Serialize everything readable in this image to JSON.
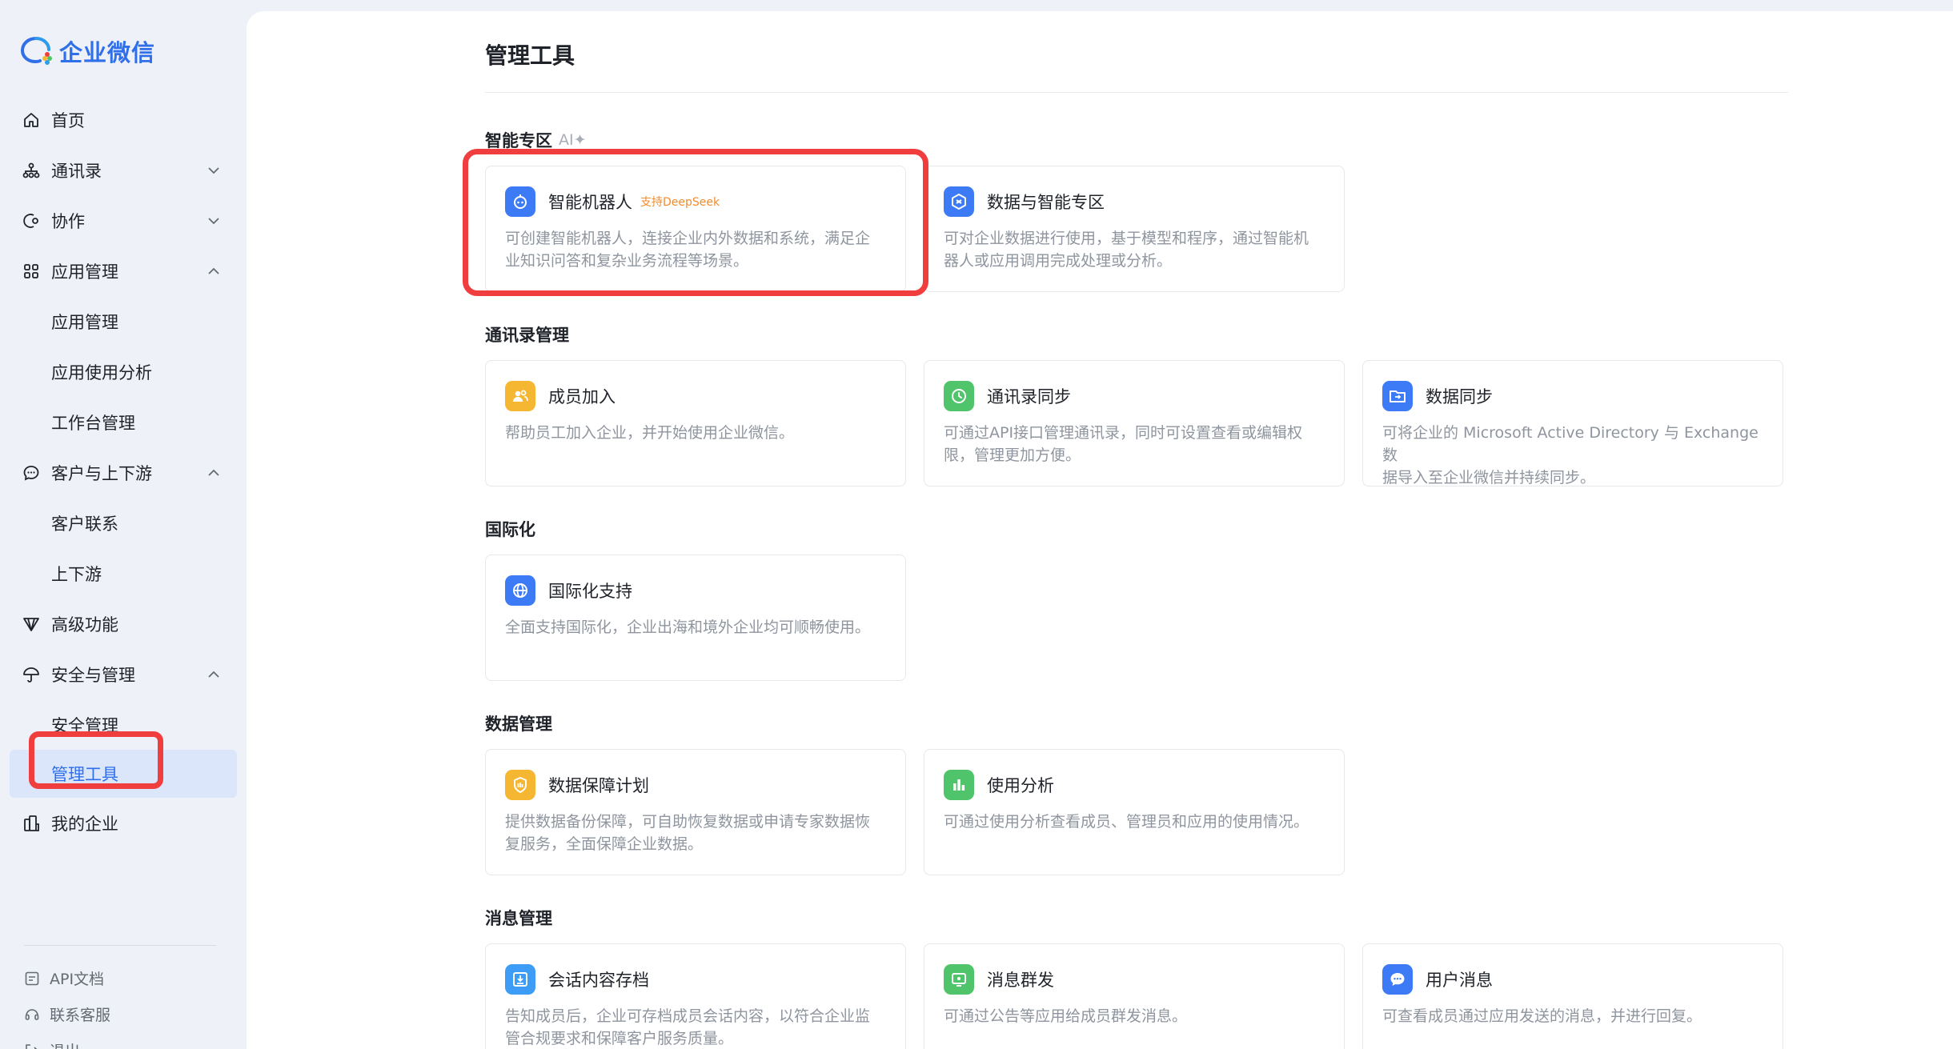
{
  "logo": {
    "text": "企业微信"
  },
  "sidebar": {
    "items": [
      {
        "label": "首页",
        "icon": "home-icon"
      },
      {
        "label": "通讯录",
        "icon": "org-chart-icon",
        "chevron": "down"
      },
      {
        "label": "协作",
        "icon": "collab-icon",
        "chevron": "down"
      },
      {
        "label": "应用管理",
        "icon": "apps-grid-icon",
        "chevron": "up"
      },
      {
        "label": "应用管理",
        "sub": true
      },
      {
        "label": "应用使用分析",
        "sub": true
      },
      {
        "label": "工作台管理",
        "sub": true
      },
      {
        "label": "客户与上下游",
        "icon": "chat-bubble-icon",
        "chevron": "up"
      },
      {
        "label": "客户联系",
        "sub": true
      },
      {
        "label": "上下游",
        "sub": true
      },
      {
        "label": "高级功能",
        "icon": "diamond-icon"
      },
      {
        "label": "安全与管理",
        "icon": "umbrella-icon",
        "chevron": "up"
      },
      {
        "label": "安全管理",
        "sub": true
      },
      {
        "label": "管理工具",
        "sub": true,
        "active": true
      },
      {
        "label": "我的企业",
        "icon": "building-icon"
      }
    ],
    "footer": [
      {
        "label": "API文档",
        "icon": "doc-icon"
      },
      {
        "label": "联系客服",
        "icon": "headset-icon"
      },
      {
        "label": "退出",
        "icon": "logout-icon"
      }
    ]
  },
  "main": {
    "title": "管理工具",
    "sections": [
      {
        "title": "智能专区",
        "tag": "AI✦",
        "cards": [
          {
            "title": "智能机器人",
            "badge": "支持DeepSeek",
            "desc_line1": "可创建智能机器人，连接企业内外数据和系统，满足企",
            "desc_line2": "业知识问答和复杂业务流程等场景。",
            "icon": "robot-icon",
            "color": "#3d7af5"
          },
          {
            "title": "数据与智能专区",
            "desc_line1": "可对企业数据进行使用，基于模型和程序，通过智能机",
            "desc_line2": "器人或应用调用完成处理或分析。",
            "icon": "data-cube-icon",
            "color": "#3d7af5"
          }
        ]
      },
      {
        "title": "通讯录管理",
        "cards": [
          {
            "title": "成员加入",
            "desc_line1": "帮助员工加入企业，并开始使用企业微信。",
            "desc_line2": "",
            "icon": "members-icon",
            "color": "#f5b731"
          },
          {
            "title": "通讯录同步",
            "desc_line1": "可通过API接口管理通讯录，同时可设置查看或编辑权",
            "desc_line2": "限，管理更加方便。",
            "icon": "sync-icon",
            "color": "#4fc46a"
          },
          {
            "title": "数据同步",
            "desc_line1": "可将企业的 Microsoft Active Directory 与 Exchange 数",
            "desc_line2": "据导入至企业微信并持续同步。",
            "icon": "folder-sync-icon",
            "color": "#3d7af5"
          }
        ]
      },
      {
        "title": "国际化",
        "cards": [
          {
            "title": "国际化支持",
            "desc_line1": "全面支持国际化，企业出海和境外企业均可顺畅使用。",
            "desc_line2": "",
            "icon": "globe-icon",
            "color": "#3d7af5"
          }
        ]
      },
      {
        "title": "数据管理",
        "cards": [
          {
            "title": "数据保障计划",
            "desc_line1": "提供数据备份保障，可自助恢复数据或申请专家数据恢",
            "desc_line2": "复服务，全面保障企业数据。",
            "icon": "shield-data-icon",
            "color": "#f5b731"
          },
          {
            "title": "使用分析",
            "desc_line1": "可通过使用分析查看成员、管理员和应用的使用情况。",
            "desc_line2": "",
            "icon": "bar-chart-icon",
            "color": "#4fc46a"
          }
        ]
      },
      {
        "title": "消息管理",
        "cards": [
          {
            "title": "会话内容存档",
            "desc_line1": "告知成员后，企业可存档成员会话内容，以符合企业监",
            "desc_line2": "管合规要求和保障客户服务质量。",
            "icon": "archive-icon",
            "color": "#3d9cf5"
          },
          {
            "title": "消息群发",
            "desc_line1": "可通过公告等应用给成员群发消息。",
            "desc_line2": "",
            "icon": "broadcast-icon",
            "color": "#4fc46a"
          },
          {
            "title": "用户消息",
            "desc_line1": "可查看成员通过应用发送的消息，并进行回复。",
            "desc_line2": "",
            "icon": "message-icon",
            "color": "#3d7af5"
          }
        ]
      }
    ]
  }
}
